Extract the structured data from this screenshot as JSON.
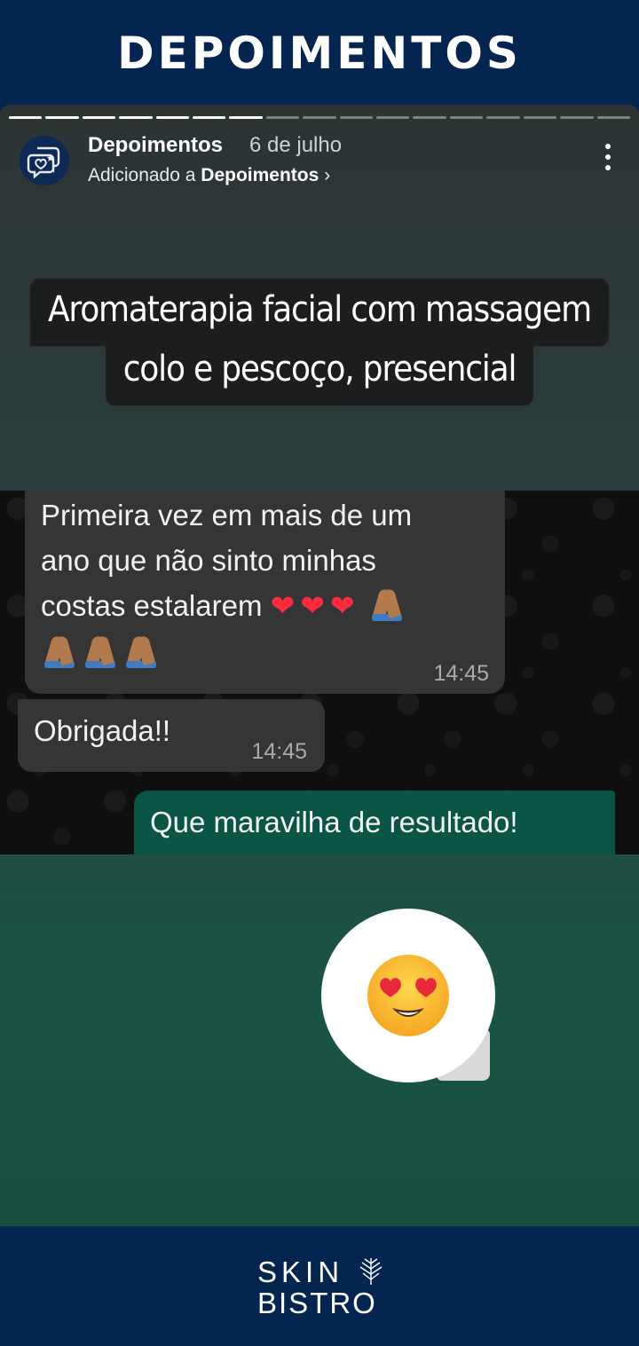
{
  "banner": {
    "title": "DEPOIMENTOS"
  },
  "story": {
    "progress": {
      "segments_total": 17,
      "segments_viewed": 7
    },
    "header": {
      "account_name": "Depoimentos",
      "date": "6 de julho",
      "added_prefix": "Adicionado a",
      "added_highlight": "Depoimentos",
      "chevron": "›",
      "avatar_icon": "chat-hearts-icon",
      "menu_icon": "more-vertical-icon"
    },
    "caption": {
      "line1": "Aromaterapia facial com massagem",
      "line2": "colo e pescoço, presencial"
    },
    "chat": {
      "message1": {
        "line1": "Primeira vez em mais de um",
        "line2": "ano que não sinto minhas",
        "line3": "costas estalarem",
        "hearts": "❤❤❤",
        "time": "14:45"
      },
      "message2": {
        "text": "Obrigada!!",
        "time": "14:45"
      },
      "message3": {
        "text": "Que maravilha de resultado!"
      }
    },
    "reaction": {
      "emoji": "heart-eyes-emoji"
    }
  },
  "footer": {
    "logo_line1": "SKIN",
    "logo_line2": "BISTRO"
  },
  "colors": {
    "navy": "#03254f",
    "bubble_incoming": "#353535",
    "bubble_outgoing": "#0b5545",
    "caption_bg": "#1c1e1e"
  }
}
